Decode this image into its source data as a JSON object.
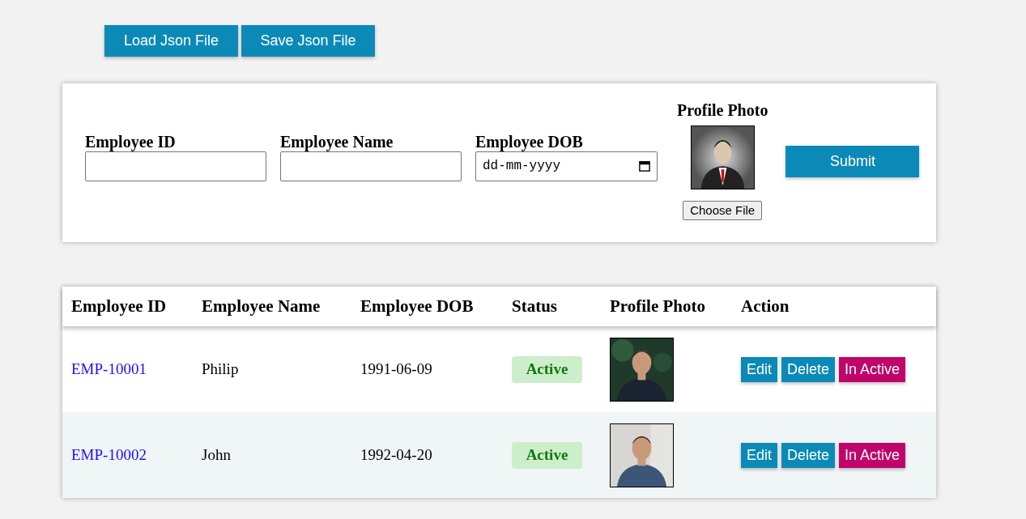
{
  "toolbar": {
    "buttons": [
      "Load Json File",
      "Save Json File"
    ]
  },
  "form": {
    "fields": [
      {
        "label": "Employee ID",
        "kind": "text"
      },
      {
        "label": "Employee Name",
        "kind": "text"
      },
      {
        "label": "Employee DOB",
        "kind": "date",
        "placeholder": "dd-mm-yyyy"
      }
    ],
    "photo": {
      "label": "Profile Photo",
      "button": "Choose File"
    },
    "submit": "Submit"
  },
  "table": {
    "columns": [
      "Employee ID",
      "Employee Name",
      "Employee DOB",
      "Status",
      "Profile Photo",
      "Action"
    ],
    "rows": [
      {
        "id": "EMP-10001",
        "name": "Philip",
        "dob": "1991-06-09",
        "status": "Active",
        "actions": [
          "Edit",
          "Delete",
          "In Active"
        ]
      },
      {
        "id": "EMP-10002",
        "name": "John",
        "dob": "1992-04-20",
        "status": "Active",
        "actions": [
          "Edit",
          "Delete",
          "In Active"
        ]
      }
    ]
  }
}
